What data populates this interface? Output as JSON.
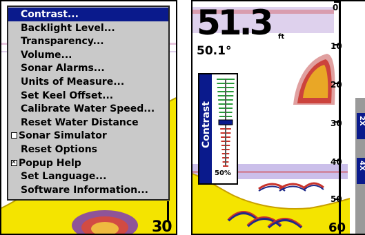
{
  "left_screen": {
    "menu": {
      "items": [
        {
          "label": "Contrast...",
          "selected": true,
          "check": "none"
        },
        {
          "label": "Backlight Level...",
          "selected": false,
          "check": "none"
        },
        {
          "label": "Transparency...",
          "selected": false,
          "check": "none"
        },
        {
          "label": "Volume...",
          "selected": false,
          "check": "none"
        },
        {
          "label": "Sonar Alarms...",
          "selected": false,
          "check": "none"
        },
        {
          "label": "Units of Measure...",
          "selected": false,
          "check": "none"
        },
        {
          "label": "Set Keel Offset...",
          "selected": false,
          "check": "none"
        },
        {
          "label": "Calibrate Water Speed...",
          "selected": false,
          "check": "none"
        },
        {
          "label": "Reset Water Distance",
          "selected": false,
          "check": "none"
        },
        {
          "label": "Sonar Simulator",
          "selected": false,
          "check": "unchecked"
        },
        {
          "label": "Reset Options",
          "selected": false,
          "check": "none"
        },
        {
          "label": "Popup Help",
          "selected": false,
          "check": "checked"
        },
        {
          "label": "Set Language...",
          "selected": false,
          "check": "none"
        },
        {
          "label": "Software Information...",
          "selected": false,
          "check": "none"
        }
      ]
    },
    "bottom_depth_label": "30"
  },
  "right_screen": {
    "depth_value": "51.3",
    "depth_unit": "ft",
    "water_temp": "50.1°",
    "depth_scale": [
      "0",
      "10",
      "20",
      "30",
      "40",
      "50",
      "60"
    ],
    "contrast_popup": {
      "title": "Contrast",
      "percent_label": "50%",
      "level_fraction": 0.5
    },
    "zoom_tabs": [
      "2X",
      "4X"
    ]
  },
  "colors": {
    "menu_highlight": "#0a1a8c",
    "menu_bg": "#c9c9c9",
    "bottom_fill": "#f4e400",
    "sonar_red": "#c8322a",
    "sonar_blue": "#1e2a8a"
  }
}
